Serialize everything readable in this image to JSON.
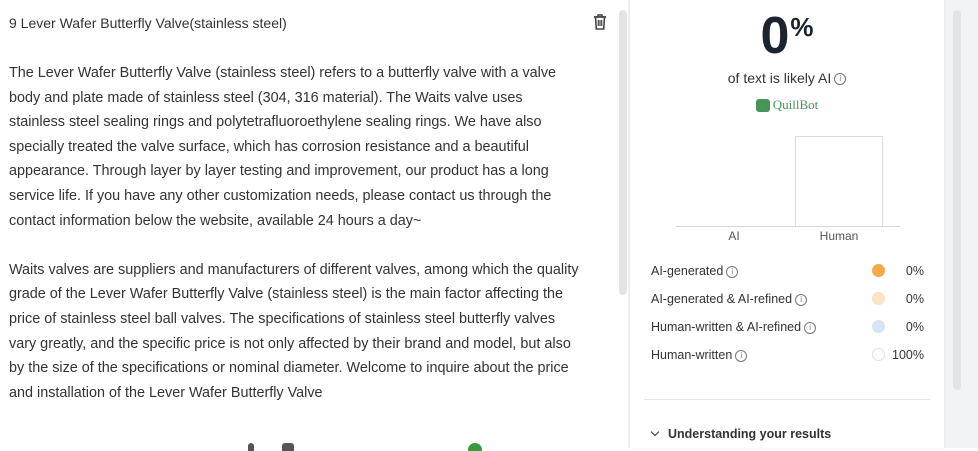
{
  "document": {
    "title": "9 Lever Wafer Butterfly Valve(stainless steel)",
    "paragraphs": [
      "The Lever Wafer Butterfly Valve (stainless steel) refers to a butterfly valve with a valve body and plate made of stainless steel (304, 316 material). The Waits valve uses stainless steel sealing rings and polytetrafluoroethylene sealing rings. We have also specially treated the valve surface, which has corrosion resistance and a beautiful appearance. Through layer by layer testing and improvement, our product has a long service life. If you have any other customization needs, please contact us through the contact information below the website, available 24 hours a day~",
      "Waits valves are suppliers and manufacturers of different valves, among which the quality grade of the Lever Wafer Butterfly Valve (stainless steel) is the main factor affecting the price of stainless steel ball valves. The specifications of stainless steel butterfly valves vary greatly, and the specific price is not only affected by their brand and model, but also by the size of the specifications or nominal diameter. Welcome to inquire about the price and installation of the Lever Wafer Butterfly Valve"
    ],
    "delete_icon": "trash-icon"
  },
  "result": {
    "score": "0",
    "percent_symbol": "%",
    "subtitle": "of text is likely AI",
    "info_icon": "info-icon",
    "brand": "QuillBot"
  },
  "chart_data": {
    "type": "bar",
    "categories": [
      "AI",
      "Human"
    ],
    "values": [
      0,
      100
    ],
    "ylim": [
      0,
      100
    ]
  },
  "breakdown": [
    {
      "label": "AI-generated",
      "value": "0%",
      "color": "#f6a94a",
      "border": "#f6a94a"
    },
    {
      "label": "AI-generated & AI-refined",
      "value": "0%",
      "color": "#fbe3c6",
      "border": "#fbe3c6"
    },
    {
      "label": "Human-written & AI-refined",
      "value": "0%",
      "color": "#d7e4f6",
      "border": "#d7e4f6"
    },
    {
      "label": "Human-written",
      "value": "100%",
      "color": "#ffffff",
      "border": "#e0e0e0"
    }
  ],
  "understanding": {
    "label": "Understanding your results",
    "icon": "chevron-down-icon"
  }
}
